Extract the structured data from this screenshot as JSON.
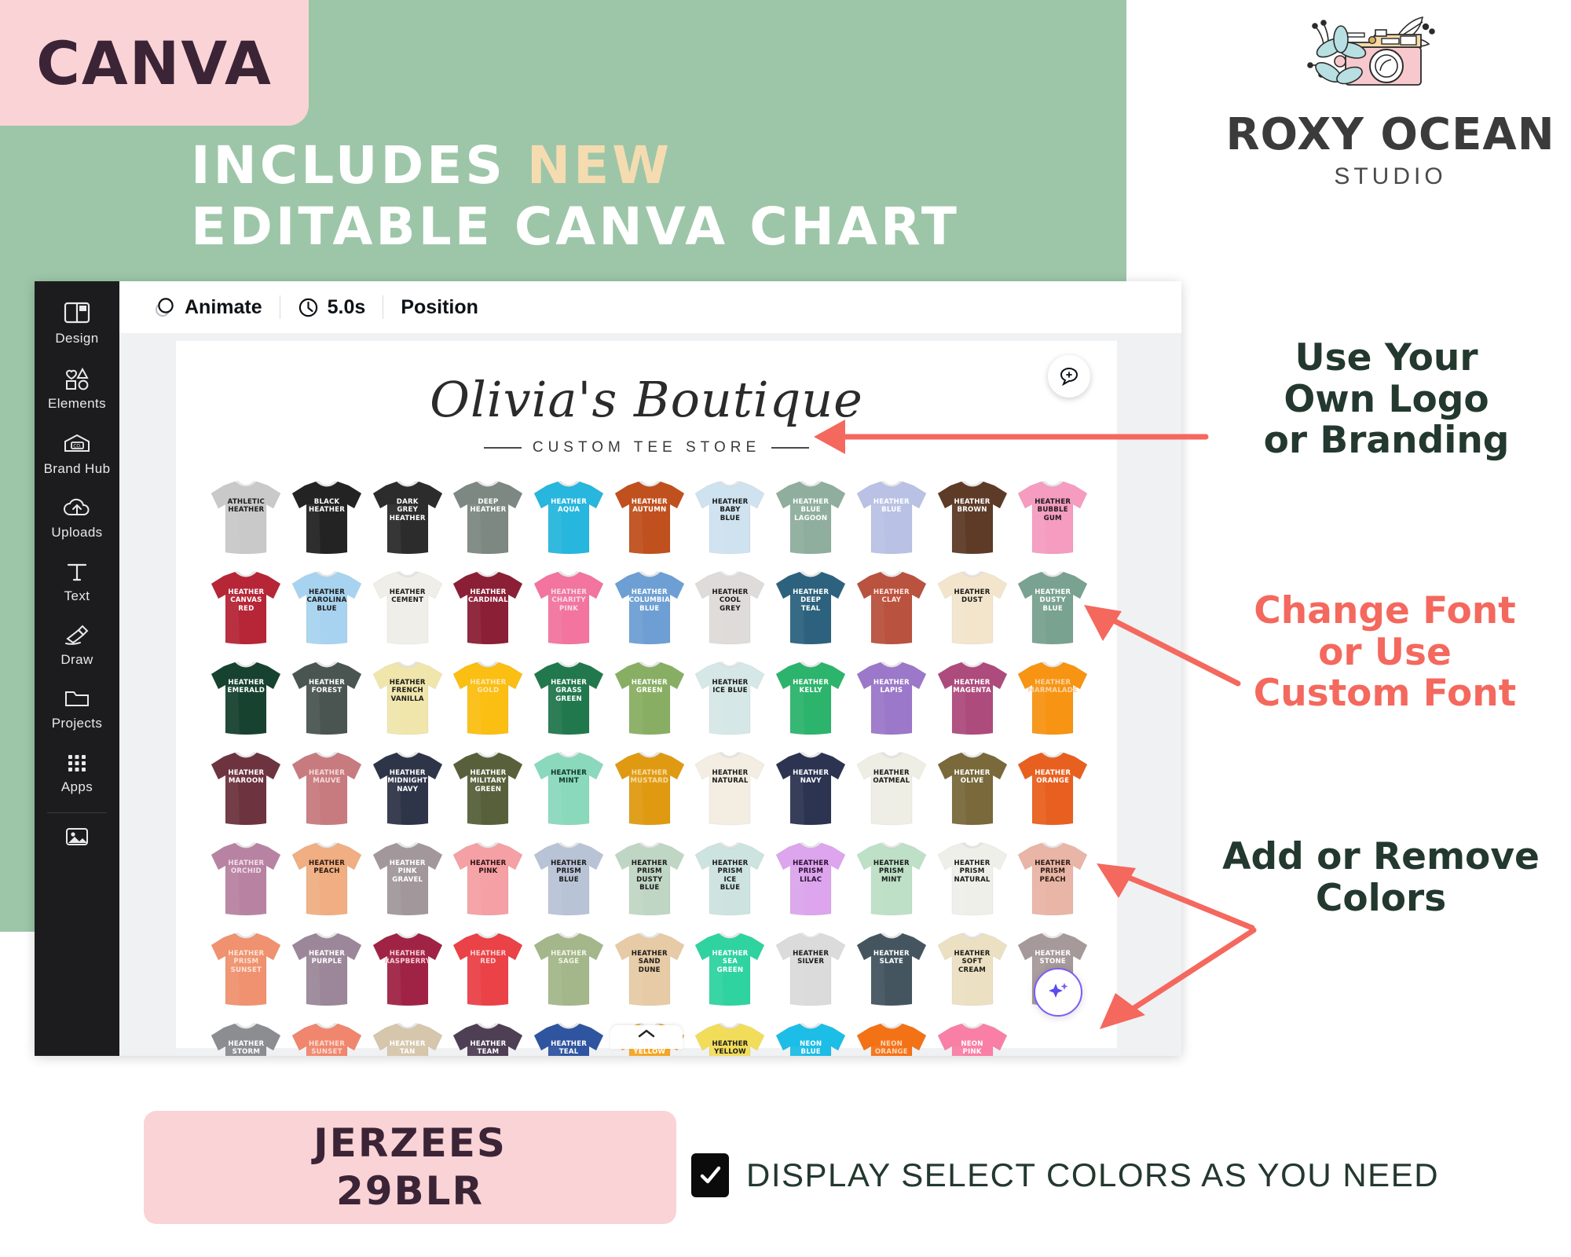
{
  "promo": {
    "badge": "CANVA",
    "line1_white": "INCLUDES ",
    "line1_accent": "NEW",
    "line2": "EDITABLE CANVA CHART",
    "accent_color": "#f5dcb0",
    "panel_color": "#9dc6a8",
    "badge_bg": "#fad3d6"
  },
  "studio_logo": {
    "name": "ROXY OCEAN",
    "sub": "STUDIO",
    "mark": "camera-flower-icon"
  },
  "canva": {
    "sidebar": [
      {
        "label": "Design",
        "icon": "design-icon"
      },
      {
        "label": "Elements",
        "icon": "elements-icon"
      },
      {
        "label": "Brand Hub",
        "icon": "brand-hub-icon"
      },
      {
        "label": "Uploads",
        "icon": "uploads-icon"
      },
      {
        "label": "Text",
        "icon": "text-icon"
      },
      {
        "label": "Draw",
        "icon": "draw-icon"
      },
      {
        "label": "Projects",
        "icon": "projects-icon"
      },
      {
        "label": "Apps",
        "icon": "apps-icon"
      }
    ],
    "toolbar": {
      "animate": "Animate",
      "duration": "5.0s",
      "position": "Position",
      "animate_icon": "animate-icon",
      "clock_icon": "clock-icon"
    },
    "comment_icon": "comment-icon",
    "magic_icon": "magic-sparkle-icon",
    "collapse_icon": "chevron-up-icon"
  },
  "design": {
    "brand_name": "Olivia's Boutique",
    "brand_sub": "CUSTOM TEE STORE"
  },
  "chart_data": {
    "type": "table",
    "title": "Olivia's Boutique — Custom Tee Store color chart",
    "product": "JERZEES 29BLR",
    "columns": 11,
    "rows": [
      [
        {
          "name": "ATHLETIC\nHEATHER",
          "shirt": "#c9c9c9",
          "text": "#1b1b1b"
        },
        {
          "name": "BLACK\nHEATHER",
          "shirt": "#232323",
          "text": "#ffffff"
        },
        {
          "name": "DARK\nGREY\nHEATHER",
          "shirt": "#2c2c2c",
          "text": "#ffffff"
        },
        {
          "name": "DEEP\nHEATHER",
          "shirt": "#7d8882",
          "text": "#ffffff"
        },
        {
          "name": "HEATHER\nAQUA",
          "shirt": "#27b6dd",
          "text": "#ffffff"
        },
        {
          "name": "HEATHER\nAUTUMN",
          "shirt": "#c0501d",
          "text": "#ffffff"
        },
        {
          "name": "HEATHER\nBABY\nBLUE",
          "shirt": "#cfe2f0",
          "text": "#1b1b1b"
        },
        {
          "name": "HEATHER\nBLUE\nLAGOON",
          "shirt": "#8fae9e",
          "text": "#ffffff"
        },
        {
          "name": "HEATHER\nBLUE",
          "shirt": "#b9c2e4",
          "text": "#ffffff"
        },
        {
          "name": "HEATHER\nBROWN",
          "shirt": "#5d3b27",
          "text": "#ffffff"
        },
        {
          "name": "HEATHER\nBUBBLE\nGUM",
          "shirt": "#f59cc0",
          "text": "#1b1b1b"
        }
      ],
      [
        {
          "name": "HEATHER\nCANVAS\nRED",
          "shirt": "#b62637",
          "text": "#ffffff"
        },
        {
          "name": "HEATHER\nCAROLINA\nBLUE",
          "shirt": "#a8d3f0",
          "text": "#1b1b1b"
        },
        {
          "name": "HEATHER\nCEMENT",
          "shirt": "#efeee8",
          "text": "#1b1b1b"
        },
        {
          "name": "HEATHER\nCARDINAL",
          "shirt": "#8b1f35",
          "text": "#ffffff"
        },
        {
          "name": "HEATHER\nCHARITY\nPINK",
          "shirt": "#f2749f",
          "text": "#f7dde8"
        },
        {
          "name": "HEATHER\nCOLUMBIA\nBLUE",
          "shirt": "#6d9fd4",
          "text": "#ffffff"
        },
        {
          "name": "HEATHER\nCOOL\nGREY",
          "shirt": "#dedbd9",
          "text": "#1b1b1b"
        },
        {
          "name": "HEATHER\nDEEP\nTEAL",
          "shirt": "#2d627e",
          "text": "#ffffff"
        },
        {
          "name": "HEATHER\nCLAY",
          "shirt": "#b9523f",
          "text": "#ffe7df"
        },
        {
          "name": "HEATHER\nDUST",
          "shirt": "#f3e5cc",
          "text": "#1b1b1b"
        },
        {
          "name": "HEATHER\nDUSTY\nBLUE",
          "shirt": "#79a290",
          "text": "#ffffff"
        }
      ],
      [
        {
          "name": "HEATHER\nEMERALD",
          "shirt": "#17422f",
          "text": "#ffffff"
        },
        {
          "name": "HEATHER\nFOREST",
          "shirt": "#4a5552",
          "text": "#ffffff"
        },
        {
          "name": "HEATHER\nFRENCH\nVANILLA",
          "shirt": "#f0e6ac",
          "text": "#1b1b1b"
        },
        {
          "name": "HEATHER\nGOLD",
          "shirt": "#fbbe12",
          "text": "#fde9b8"
        },
        {
          "name": "HEATHER\nGRASS\nGREEN",
          "shirt": "#22784d",
          "text": "#ffffff"
        },
        {
          "name": "HEATHER\nGREEN",
          "shirt": "#88ae63",
          "text": "#ffffff"
        },
        {
          "name": "HEATHER\nICE BLUE",
          "shirt": "#d5e7e6",
          "text": "#1b1b1b"
        },
        {
          "name": "HEATHER\nKELLY",
          "shirt": "#2cb46c",
          "text": "#ffffff"
        },
        {
          "name": "HEATHER\nLAPIS",
          "shirt": "#9b78c9",
          "text": "#ffffff"
        },
        {
          "name": "HEATHER\nMAGENTA",
          "shirt": "#ad4b7d",
          "text": "#ffffff"
        },
        {
          "name": "HEATHER\nMARMALADE",
          "shirt": "#f79413",
          "text": "#fbd6a6"
        }
      ],
      [
        {
          "name": "HEATHER\nMAROON",
          "shirt": "#6d3440",
          "text": "#ffffff"
        },
        {
          "name": "HEATHER\nMAUVE",
          "shirt": "#c87b7f",
          "text": "#f7dada"
        },
        {
          "name": "HEATHER\nMIDNIGHT\nNAVY",
          "shirt": "#2f3548",
          "text": "#ffffff"
        },
        {
          "name": "HEATHER\nMILITARY\nGREEN",
          "shirt": "#57603a",
          "text": "#ffffff"
        },
        {
          "name": "HEATHER\nMINT",
          "shirt": "#8ad9bd",
          "text": "#11352a"
        },
        {
          "name": "HEATHER\nMUSTARD",
          "shirt": "#e09a12",
          "text": "#f7dda3"
        },
        {
          "name": "HEATHER\nNATURAL",
          "shirt": "#f4ede1",
          "text": "#1b1b1b"
        },
        {
          "name": "HEATHER\nNAVY",
          "shirt": "#2c3452",
          "text": "#ffffff"
        },
        {
          "name": "HEATHER\nOATMEAL",
          "shirt": "#eeeee5",
          "text": "#1b1b1b"
        },
        {
          "name": "HEATHER\nOLIVE",
          "shirt": "#79693b",
          "text": "#ffffff"
        },
        {
          "name": "HEATHER\nORANGE",
          "shirt": "#e8601f",
          "text": "#ffffff"
        }
      ],
      [
        {
          "name": "HEATHER\nORCHID",
          "shirt": "#b883a2",
          "text": "#f2dde9"
        },
        {
          "name": "HEATHER\nPEACH",
          "shirt": "#f0ae82",
          "text": "#2a1a12"
        },
        {
          "name": "HEATHER\nPINK\nGRAVEL",
          "shirt": "#a2989b",
          "text": "#ffffff"
        },
        {
          "name": "HEATHER\nPINK",
          "shirt": "#f5a0a4",
          "text": "#2a1212"
        },
        {
          "name": "HEATHER\nPRISM\nBLUE",
          "shirt": "#b9c3d6",
          "text": "#1b1b1b"
        },
        {
          "name": "HEATHER\nPRISM\nDUSTY\nBLUE",
          "shirt": "#c0d6c5",
          "text": "#1b1b1b"
        },
        {
          "name": "HEATHER\nPRISM\nICE\nBLUE",
          "shirt": "#cde3df",
          "text": "#1b1b1b"
        },
        {
          "name": "HEATHER\nPRISM\nLILAC",
          "shirt": "#dca5ed",
          "text": "#2a1030"
        },
        {
          "name": "HEATHER\nPRISM\nMINT",
          "shirt": "#bde0c6",
          "text": "#1b1b1b"
        },
        {
          "name": "HEATHER\nPRISM\nNATURAL",
          "shirt": "#efefea",
          "text": "#1b1b1b"
        },
        {
          "name": "HEATHER\nPRISM\nPEACH",
          "shirt": "#e9b5a6",
          "text": "#2a1a12"
        }
      ],
      [
        {
          "name": "HEATHER\nPRISM\nSUNSET",
          "shirt": "#f0926f",
          "text": "#fce3d6"
        },
        {
          "name": "HEATHER\nPURPLE",
          "shirt": "#9b8799",
          "text": "#ffffff"
        },
        {
          "name": "HEATHER\nRASPBERRY",
          "shirt": "#a02345",
          "text": "#f7cdd8"
        },
        {
          "name": "HEATHER\nRED",
          "shirt": "#ea4247",
          "text": "#fbd3d1"
        },
        {
          "name": "HEATHER\nSAGE",
          "shirt": "#a4b78b",
          "text": "#f2f5e9"
        },
        {
          "name": "HEATHER\nSAND\nDUNE",
          "shirt": "#e7cba6",
          "text": "#1b1b1b"
        },
        {
          "name": "HEATHER\nSEA\nGREEN",
          "shirt": "#2fd3a0",
          "text": "#ffffff"
        },
        {
          "name": "HEATHER\nSILVER",
          "shirt": "#dbdbdb",
          "text": "#1b1b1b"
        },
        {
          "name": "HEATHER\nSLATE",
          "shirt": "#44555f",
          "text": "#ffffff"
        },
        {
          "name": "HEATHER\nSOFT\nCREAM",
          "shirt": "#ece0c2",
          "text": "#1b1b1b"
        },
        {
          "name": "HEATHER\nSTONE",
          "shirt": "#a6999a",
          "text": "#ffffff"
        }
      ],
      [
        {
          "name": "HEATHER\nSTORM",
          "shirt": "#8b8d91",
          "text": "#ffffff"
        },
        {
          "name": "HEATHER\nSUNSET",
          "shirt": "#f0866d",
          "text": "#fbdcd2"
        },
        {
          "name": "HEATHER\nTAN",
          "shirt": "#d6c6ac",
          "text": "#ffffff"
        },
        {
          "name": "HEATHER\nTEAM",
          "shirt": "#4e3f55",
          "text": "#ffffff"
        },
        {
          "name": "HEATHER\nTEAL",
          "shirt": "#2f55a0",
          "text": "#ffffff"
        },
        {
          "name": "HEATHER\nYELLOW",
          "shirt": "#f5a623",
          "text": "#ffffff"
        },
        {
          "name": "HEATHER\nYELLOW",
          "shirt": "#f2dd5a",
          "text": "#1b1b1b"
        },
        {
          "name": "NEON\nBLUE",
          "shirt": "#1cbde6",
          "text": "#ffffff"
        },
        {
          "name": "NEON\nORANGE",
          "shirt": "#f47216",
          "text": "#fbd8bb"
        },
        {
          "name": "NEON\nPINK",
          "shirt": "#f97fa7",
          "text": "#ffffff"
        }
      ]
    ]
  },
  "annotations": [
    {
      "text": "Use Your\nOwn Logo\nor Branding",
      "color": "#23382f"
    },
    {
      "text": "Change Font\nor Use\nCustom Font",
      "color": "#f4685e"
    },
    {
      "text": "Add or Remove\nColors",
      "color": "#23382f"
    }
  ],
  "footer": {
    "brand_line1": "JERZEES",
    "brand_line2": "29BLR",
    "checkbox_label": "DISPLAY SELECT COLORS AS YOU NEED",
    "checkbox_checked": true,
    "chip_bg": "#fad3d6"
  }
}
